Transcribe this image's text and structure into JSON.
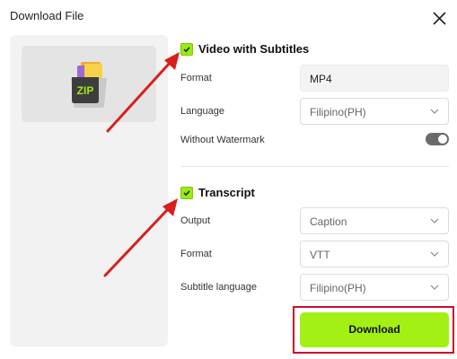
{
  "dialog": {
    "title": "Download File",
    "close_icon": "close-icon"
  },
  "preview": {
    "icon": "zip-archive-icon",
    "icon_text": "ZIP"
  },
  "video_section": {
    "checked": true,
    "heading": "Video with Subtitles",
    "format_label": "Format",
    "format_value": "MP4",
    "language_label": "Language",
    "language_value": "Filipino(PH)",
    "watermark_label": "Without Watermark",
    "watermark_enabled": true
  },
  "transcript_section": {
    "checked": true,
    "heading": "Transcript",
    "output_label": "Output",
    "output_value": "Caption",
    "format_label": "Format",
    "format_value": "VTT",
    "subtitle_language_label": "Subtitle language",
    "subtitle_language_value": "Filipino(PH)"
  },
  "download_label": "Download",
  "colors": {
    "accent": "#a4ef14",
    "annotation": "#d81e1e",
    "highlight_frame": "#c8102e"
  }
}
